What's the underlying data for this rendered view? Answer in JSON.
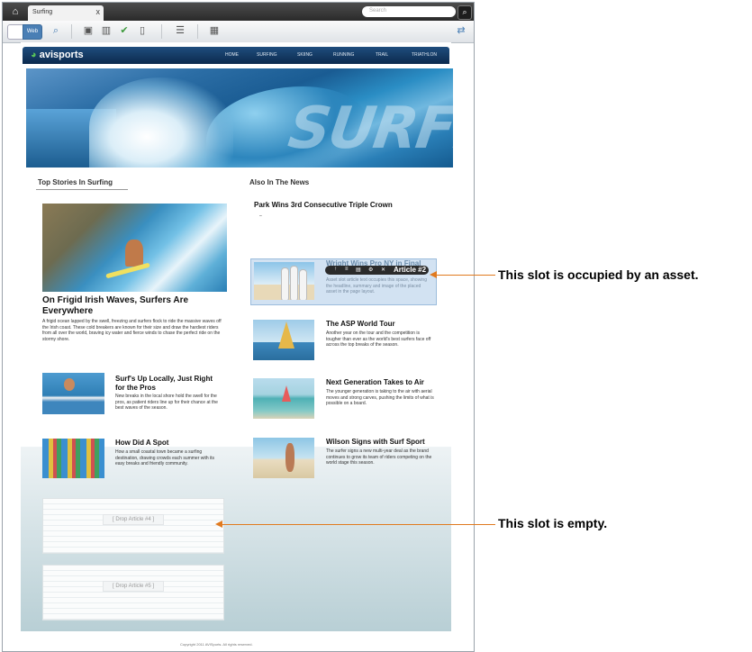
{
  "browser": {
    "tab_title": "Surfing",
    "tab_close": "x",
    "search_placeholder": "Search"
  },
  "toolbar": {
    "mode_selected": "Web"
  },
  "site": {
    "logo": "avisports",
    "nav": [
      "HOME",
      "SURFING",
      "SKIING",
      "RUNNING",
      "TRAIL",
      "TRIATHLON"
    ],
    "hero_title": "SURFING"
  },
  "sections": {
    "top_stories": "Top Stories In Surfing",
    "also_in_news": "Also In The News"
  },
  "top_stories": {
    "main": {
      "headline": "On Frigid Irish Waves, Surfers Are Everywhere",
      "body": "A frigid ocean lapped by the swell, freezing and surfers flock to ride the massive waves off the Irish coast. These cold breakers are known for their size and draw the hardiest riders from all over the world, braving icy water and fierce winds to chase the perfect ride on the stormy shore."
    },
    "items": [
      {
        "headline": "Surf's Up Locally, Just Right for the Pros",
        "body": "New breaks in the local shore hold the swell for the pros, as patient riders line up for their chance at the best waves of the season."
      },
      {
        "headline": "How Did A Spot",
        "body": "How a small coastal town became a surfing destination, drawing crowds each summer with its easy breaks and friendly community."
      }
    ],
    "empty_slots": [
      "[ Drop Article #4 ]",
      "[ Drop Article #5 ]"
    ]
  },
  "also_in_news": {
    "first": {
      "headline": "Park Wins 3rd Consecutive Triple Crown",
      "dash": "–"
    },
    "asset": {
      "headline": "Wright Wins Pro NY in Final",
      "body": "Asset slot article text occupies this space, showing the headline, summary and image of the placed asset in the page layout.",
      "badge": "Article #2",
      "tools": [
        "↑",
        "≡",
        "▤",
        "⚙",
        "✕"
      ]
    },
    "items": [
      {
        "headline": "The ASP World Tour",
        "body": "Another year on the tour and the competition is tougher than ever as the world's best surfers face off across the top breaks of the season."
      },
      {
        "headline": "Next Generation Takes to Air",
        "body": "The younger generation is taking to the air with aerial moves and strong carves, pushing the limits of what is possible on a board."
      },
      {
        "headline": "Wilson Signs with Surf Sport",
        "body": "The surfer signs a new multi-year deal as the brand continues to grow its team of riders competing on the world stage this season."
      }
    ]
  },
  "footer": "Copyright 2011 AVISports. All rights reserved.",
  "annotations": {
    "occupied": "This slot is occupied by an asset.",
    "empty": "This slot is empty."
  },
  "colors": {
    "accent_orange": "#e07a1f",
    "brand_navy": "#0c2a4e",
    "asset_highlight": "#d2e2f2"
  },
  "icons": [
    "home-icon",
    "close-icon",
    "search-icon",
    "save-icon",
    "checkin-icon",
    "approve-icon",
    "delete-icon",
    "layout-icon",
    "preview-icon",
    "refresh-icon"
  ]
}
